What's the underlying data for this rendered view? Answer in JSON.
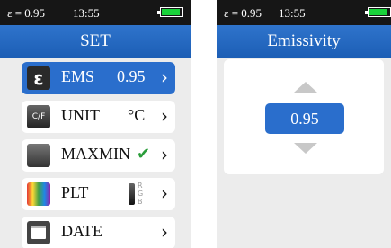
{
  "colors": {
    "accent": "#2a6ecc",
    "battery": "#19d23a",
    "check": "#2a9d3a"
  },
  "left_screen": {
    "status": {
      "emissivity": "ε = 0.95",
      "time": "13:55",
      "battery_level": 0.9
    },
    "title": "SET",
    "menu": [
      {
        "icon": "emissivity-icon",
        "label": "EMS",
        "value": "0.95",
        "selected": true
      },
      {
        "icon": "unit-icon",
        "icon_text": "C/F",
        "label": "UNIT",
        "value": "°C",
        "selected": false
      },
      {
        "icon": "maxmin-icon",
        "label": "MAXMIN",
        "value": "✔",
        "selected": false
      },
      {
        "icon": "palette-icon",
        "label": "PLT",
        "value": "RGB",
        "selected": false
      },
      {
        "icon": "calendar-icon",
        "label": "DATE",
        "value": "",
        "selected": false
      }
    ]
  },
  "right_screen": {
    "status": {
      "emissivity": "ε = 0.95",
      "time": "13:55",
      "battery_level": 0.9
    },
    "title": "Emissivity",
    "value": "0.95"
  }
}
